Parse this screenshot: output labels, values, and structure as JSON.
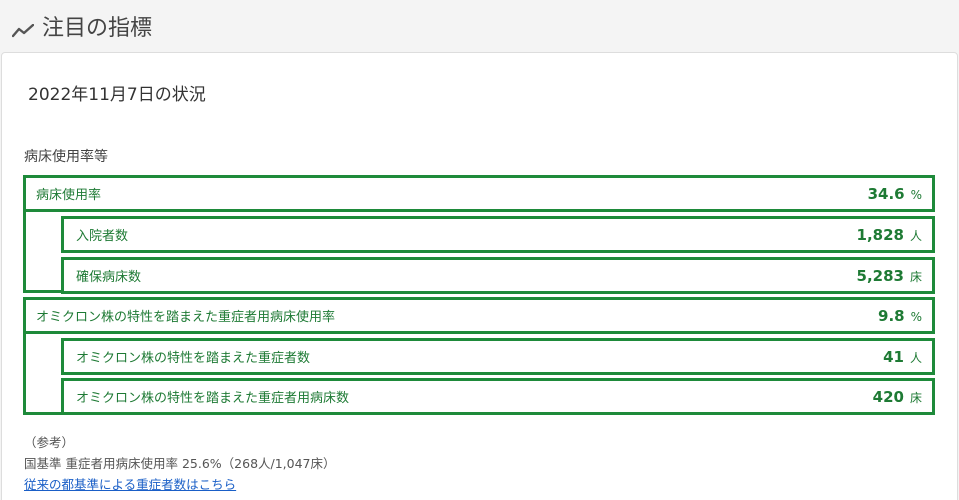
{
  "header": {
    "title": "注目の指標",
    "icon": "trend-line-icon"
  },
  "card": {
    "date_status": "2022年11月7日の状況",
    "group_heading": "病床使用率等",
    "metrics": [
      {
        "label": "病床使用率",
        "value": "34.6",
        "unit": "%"
      },
      {
        "label": "入院者数",
        "value": "1,828",
        "unit": "人"
      },
      {
        "label": "確保病床数",
        "value": "5,283",
        "unit": "床"
      },
      {
        "label": "オミクロン株の特性を踏まえた重症者用病床使用率",
        "value": "9.8",
        "unit": "%"
      },
      {
        "label": "オミクロン株の特性を踏まえた重症者数",
        "value": "41",
        "unit": "人"
      },
      {
        "label": "オミクロン株の特性を踏まえた重症者用病床数",
        "value": "420",
        "unit": "床"
      }
    ],
    "reference": {
      "heading": "（参考）",
      "note": "国基準 重症者用病床使用率 25.6%（268人/1,047床）",
      "link": "従来の都基準による重症者数はこちら"
    }
  },
  "colors": {
    "accent_green": "#1e8a3a",
    "link_blue": "#1a5fc7"
  }
}
